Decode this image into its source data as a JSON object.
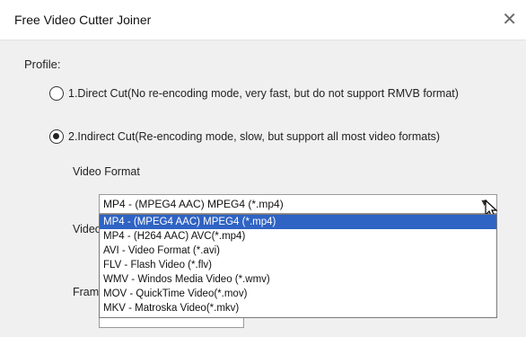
{
  "window": {
    "title": "Free Video Cutter Joiner",
    "close_glyph": "✕"
  },
  "profile": {
    "label": "Profile:",
    "options": [
      {
        "label": "1.Direct Cut(No re-encoding mode, very fast, but do not support RMVB format)",
        "checked": false
      },
      {
        "label": "2.Indirect Cut(Re-encoding mode, slow, but support all most video formats)",
        "checked": true
      }
    ]
  },
  "video_format": {
    "label": "Video Format",
    "selected_value": "MP4 - (MPEG4 AAC) MPEG4 (*.mp4)",
    "arrow_icon": "chevron-down-icon",
    "options": [
      {
        "label": "MP4 - (MPEG4 AAC) MPEG4 (*.mp4)",
        "highlighted": true
      },
      {
        "label": "MP4 - (H264 AAC) AVC(*.mp4)",
        "highlighted": false
      },
      {
        "label": "AVI - Video Format (*.avi)",
        "highlighted": false
      },
      {
        "label": "FLV - Flash Video (*.flv)",
        "highlighted": false
      },
      {
        "label": "WMV - Windos Media Video (*.wmv)",
        "highlighted": false
      },
      {
        "label": "MOV - QuickTime Video(*.mov)",
        "highlighted": false
      },
      {
        "label": "MKV - Matroska Video(*.mkv)",
        "highlighted": false
      }
    ]
  },
  "partial_labels": {
    "video_prefix": "Video",
    "frame_prefix": "Fram"
  },
  "colors": {
    "selection": "#2f63c4",
    "window_bg": "#f0f0f0"
  }
}
